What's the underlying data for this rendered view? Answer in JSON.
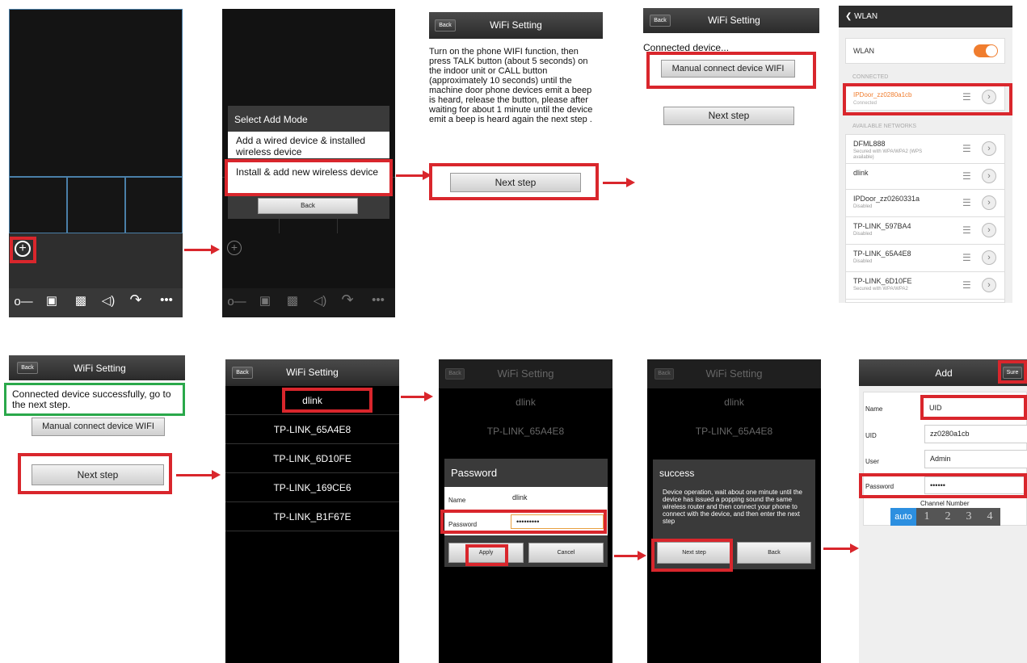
{
  "s1": {
    "icons": [
      "key-icon",
      "camera-icon",
      "video-icon",
      "speaker-icon",
      "handset-icon",
      "more-icon"
    ]
  },
  "s2": {
    "dialog_title": "Select Add Mode",
    "opt1": "Add a wired device & installed wireless device",
    "opt2": "Install & add new wireless device",
    "back": "Back"
  },
  "s3": {
    "back": "Back",
    "title": "WiFi Setting",
    "instructions": "Turn on the phone WIFI function, then press TALK button (about 5 seconds) on the indoor unit or CALL button (approximately 10 seconds) until the machine door phone devices emit a beep is heard, release the button, please after waiting for about 1 minute until the device emit a beep is heard again the next step .",
    "next": "Next step"
  },
  "s4": {
    "back": "Back",
    "title": "WiFi Setting",
    "status": "Connected device...",
    "manual": "Manual connect device WIFI",
    "next": "Next step"
  },
  "s5": {
    "header": "WLAN",
    "wlan_label": "WLAN",
    "connected_header": "CONNECTED",
    "connected": {
      "name": "IPDoor_zz0280a1cb",
      "status": "Connected"
    },
    "available_header": "AVAILABLE NETWORKS",
    "networks": [
      {
        "name": "DFML888",
        "detail": "Secured with WPA/WPA2 (WPS available)"
      },
      {
        "name": "dlink",
        "detail": ""
      },
      {
        "name": "IPDoor_zz0260331a",
        "detail": "Disabled"
      },
      {
        "name": "TP-LINK_597BA4",
        "detail": "Disabled"
      },
      {
        "name": "TP-LINK_65A4E8",
        "detail": "Disabled"
      },
      {
        "name": "TP-LINK_6D10FE",
        "detail": "Secured with WPA/WPA2"
      }
    ]
  },
  "s6": {
    "back": "Back",
    "title": "WiFi Setting",
    "status": "Connected device successfully, go to the next step.",
    "manual": "Manual connect device WIFI",
    "next": "Next step"
  },
  "s7": {
    "back": "Back",
    "title": "WiFi Setting",
    "networks": [
      "dlink",
      "TP-LINK_65A4E8",
      "TP-LINK_6D10FE",
      "TP-LINK_169CE6",
      "TP-LINK_B1F67E"
    ]
  },
  "s8": {
    "back": "Back",
    "title": "WiFi Setting",
    "bg1": "dlink",
    "bg2": "TP-LINK_65A4E8",
    "dialog_title": "Password",
    "name_label": "Name",
    "name_value": "dlink",
    "password_label": "Password",
    "password_value": "•••••••••",
    "apply": "Apply",
    "cancel": "Cancel"
  },
  "s9": {
    "back": "Back",
    "title": "WiFi Setting",
    "bg1": "dlink",
    "bg2": "TP-LINK_65A4E8",
    "dialog_title": "success",
    "message": "Device operation, wait about one minute until the device has issued a popping sound the same wireless router and then connect your phone to connect with the device, and then enter the next step",
    "next": "Next step",
    "back_btn": "Back"
  },
  "s10": {
    "title": "Add",
    "sure": "Sure",
    "name_label": "Name",
    "name_value": "UID",
    "uid_label": "UID",
    "uid_value": "zz0280a1cb",
    "user_label": "User",
    "user_value": "Admin",
    "password_label": "Password",
    "password_value": "••••••",
    "channel_label": "Channel Number",
    "channels": [
      "auto",
      "1",
      "2",
      "3",
      "4"
    ]
  },
  "colors": {
    "highlight_red": "#d9262c",
    "success_green": "#2aa84a",
    "wlan_orange": "#f07d2e"
  }
}
